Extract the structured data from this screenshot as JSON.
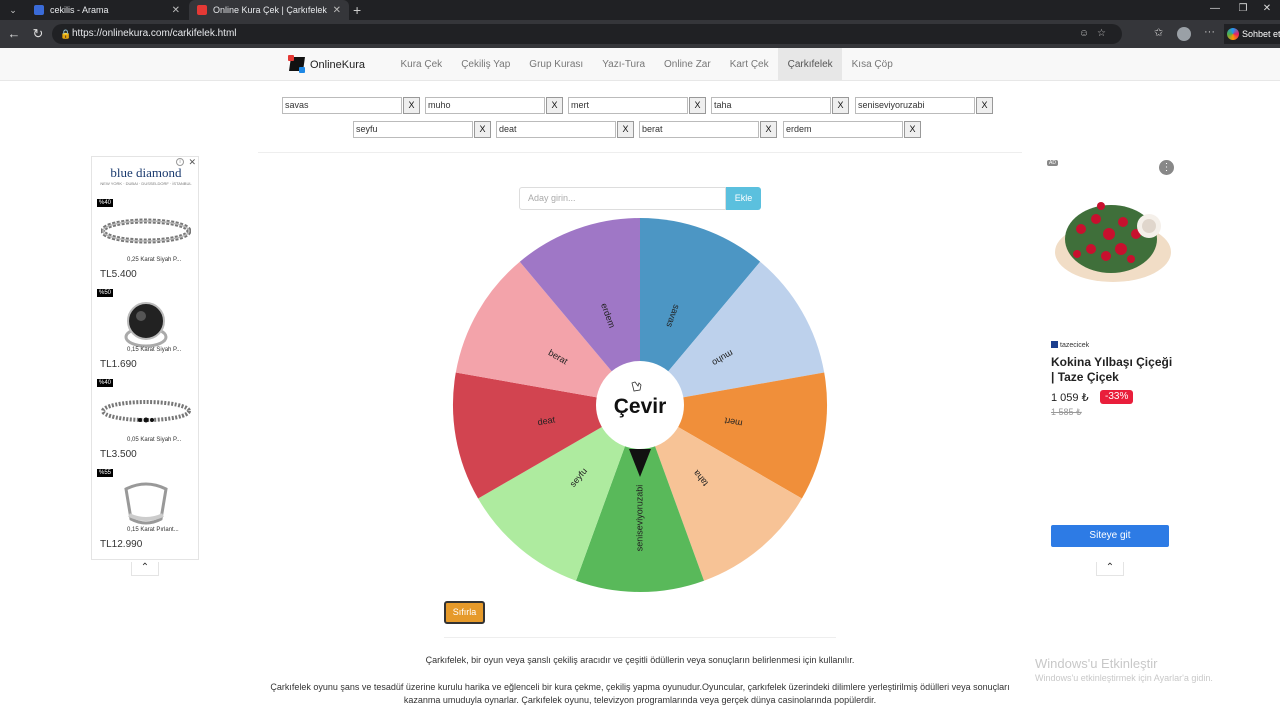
{
  "browser": {
    "tabs": [
      {
        "title": "cekilis - Arama",
        "active": false
      },
      {
        "title": "Online Kura Çek | Çarkıfelek",
        "active": true
      }
    ],
    "url": "https://onlinekura.com/carkifelek.html",
    "copilot_label": "Sohbet et"
  },
  "site": {
    "logo": "OnlineKura",
    "menu": [
      {
        "label": "Kura Çek",
        "active": false
      },
      {
        "label": "Çekiliş Yap",
        "active": false
      },
      {
        "label": "Grup Kurası",
        "active": false
      },
      {
        "label": "Yazı-Tura",
        "active": false
      },
      {
        "label": "Online Zar",
        "active": false
      },
      {
        "label": "Kart Çek",
        "active": false
      },
      {
        "label": "Çarkıfelek",
        "active": true
      },
      {
        "label": "Kısa Çöp",
        "active": false
      }
    ],
    "names": [
      "savas",
      "muho",
      "mert",
      "taha",
      "seniseviyoruzabi",
      "seyfu",
      "deat",
      "berat",
      "erdem"
    ],
    "remove_label": "X",
    "add_placeholder": "Aday girin...",
    "add_button": "Ekle",
    "spin_label": "Çevir",
    "reset_button": "Sıfırla",
    "wheel_colors": [
      "#4c96c4",
      "#bdd1ec",
      "#f08f3a",
      "#f7c396",
      "#59b95a",
      "#aeeb9f",
      "#d24450",
      "#f3a3aa",
      "#9f77c6"
    ],
    "description_1": "Çarkıfelek, bir oyun veya şanslı çekiliş aracıdır ve çeşitli ödüllerin veya sonuçların belirlenmesi için kullanılır.",
    "description_2": "Çarkıfelek oyunu şans ve tesadüf üzerine kurulu harika ve eğlenceli bir kura çekme, çekiliş yapma oyunudur.Oyuncular, çarkıfelek üzerindeki dilimlere yerleştirilmiş ödülleri veya sonuçları kazanma umuduyla oynarlar. Çarkıfelek oyunu, televizyon programlarında veya gerçek dünya casinolarında popülerdir."
  },
  "ad_left": {
    "brand": "blue diamond",
    "cities": "NEW YORK · DUBAI · DUSSELDORF · İSTANBUL",
    "products": [
      {
        "badge": "%40",
        "name": "0,25 Karat Siyah P...",
        "price": "TL5.400",
        "kind": "bracelet"
      },
      {
        "badge": "%50",
        "name": "0,15 Karat Siyah P...",
        "price": "TL1.690",
        "kind": "ring-black"
      },
      {
        "badge": "%40",
        "name": "0,05 Karat Siyah P...",
        "price": "TL3.500",
        "kind": "bracelet"
      },
      {
        "badge": "%55",
        "name": "0,15 Karat Pırlant...",
        "price": "TL12.990",
        "kind": "ring-silver"
      }
    ]
  },
  "ad_right": {
    "tag": "AD",
    "seller": "tazecicek",
    "title": "Kokina Yılbaşı Çiçeği | Taze Çiçek",
    "price": "1 059 ₺",
    "discount": "-33%",
    "old_price": "1 585 ₺",
    "cta": "Siteye git"
  },
  "watermark": {
    "line1": "Windows'u Etkinleştir",
    "line2": "Windows'u etkinleştirmek için Ayarlar'a gidin."
  }
}
